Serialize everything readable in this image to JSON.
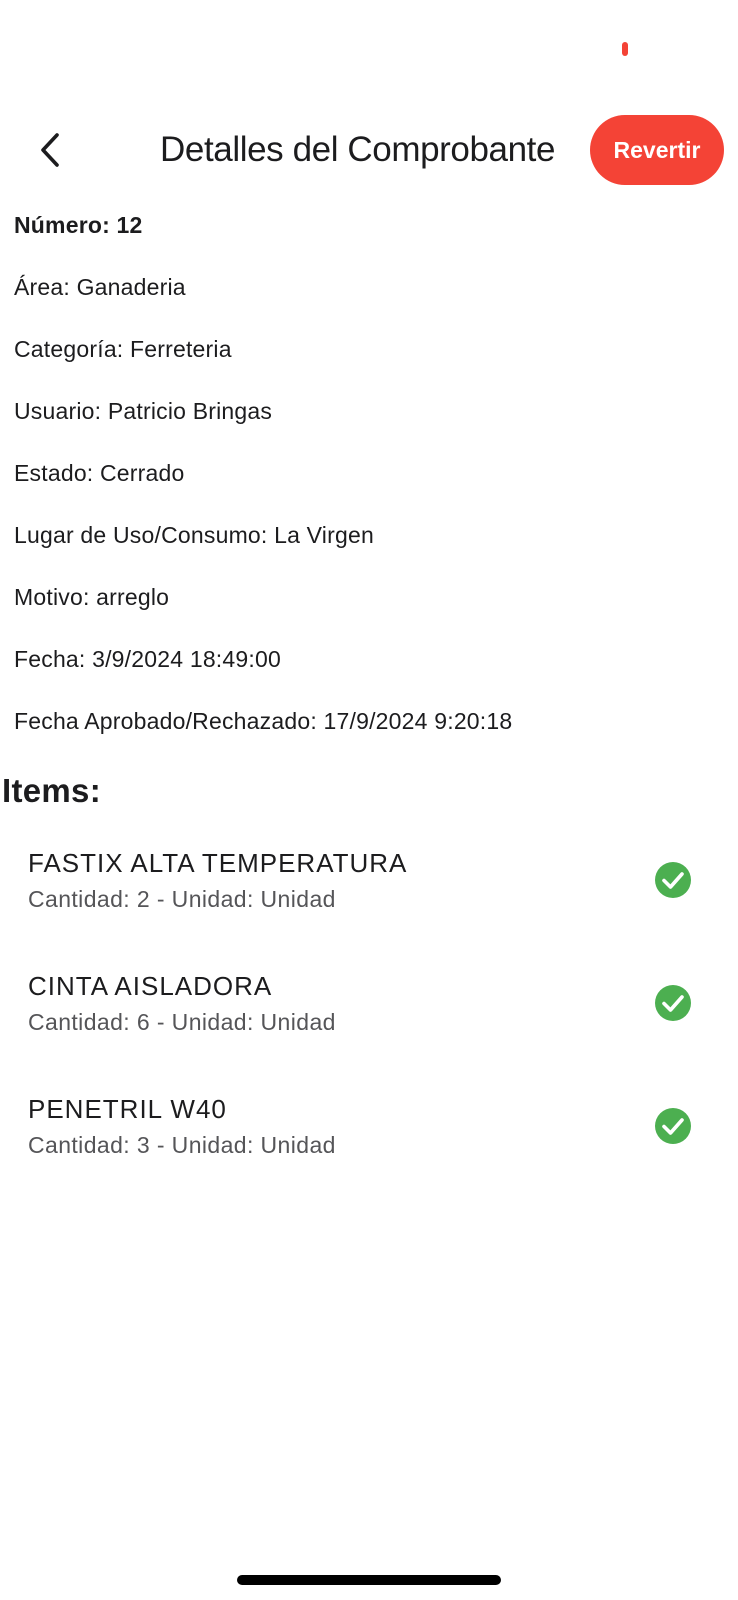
{
  "header": {
    "title": "Detalles del Comprobante",
    "revert_label": "Revertir",
    "back_icon": "chevron-left-icon"
  },
  "details": {
    "numero": "Número: 12",
    "area": "Área: Ganaderia",
    "categoria": "Categoría: Ferreteria",
    "usuario": "Usuario: Patricio Bringas",
    "estado": "Estado: Cerrado",
    "lugar": "Lugar de Uso/Consumo: La Virgen",
    "motivo": "Motivo: arreglo",
    "fecha": "Fecha: 3/9/2024 18:49:00",
    "fecha_aprobado": "Fecha Aprobado/Rechazado: 17/9/2024 9:20:18"
  },
  "items_heading": "Items:",
  "items": [
    {
      "name": "FASTIX ALTA TEMPERATURA",
      "detail": "Cantidad: 2 - Unidad: Unidad",
      "status_icon": "check-circle-icon"
    },
    {
      "name": "CINTA AISLADORA",
      "detail": "Cantidad: 6 - Unidad: Unidad",
      "status_icon": "check-circle-icon"
    },
    {
      "name": "PENETRIL W40",
      "detail": "Cantidad: 3 - Unidad: Unidad",
      "status_icon": "check-circle-icon"
    }
  ],
  "colors": {
    "accent": "#f44336",
    "success": "#4caf50",
    "text": "#1c1c1e",
    "secondary_text": "#555558"
  }
}
